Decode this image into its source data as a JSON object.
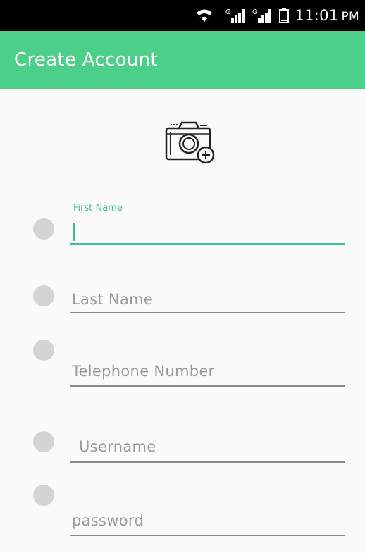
{
  "status_bar": {
    "time": "11:01",
    "ampm": "PM",
    "network_label": "G",
    "icons": [
      "wifi-icon",
      "signal-icon",
      "signal-icon",
      "battery-icon"
    ]
  },
  "app_bar": {
    "title": "Create Account",
    "color": "#4ccf88"
  },
  "profile_photo": {
    "icon": "add-photo-camera-icon"
  },
  "form": {
    "first_name": {
      "label": "First Name",
      "value": ""
    },
    "last_name": {
      "placeholder": "Last Name"
    },
    "telephone": {
      "placeholder": "Telephone Number"
    },
    "username": {
      "placeholder": "Username"
    },
    "password": {
      "placeholder": "password"
    }
  },
  "colors": {
    "accent": "#3dbf93",
    "field_icon": "#d4d4d4"
  }
}
